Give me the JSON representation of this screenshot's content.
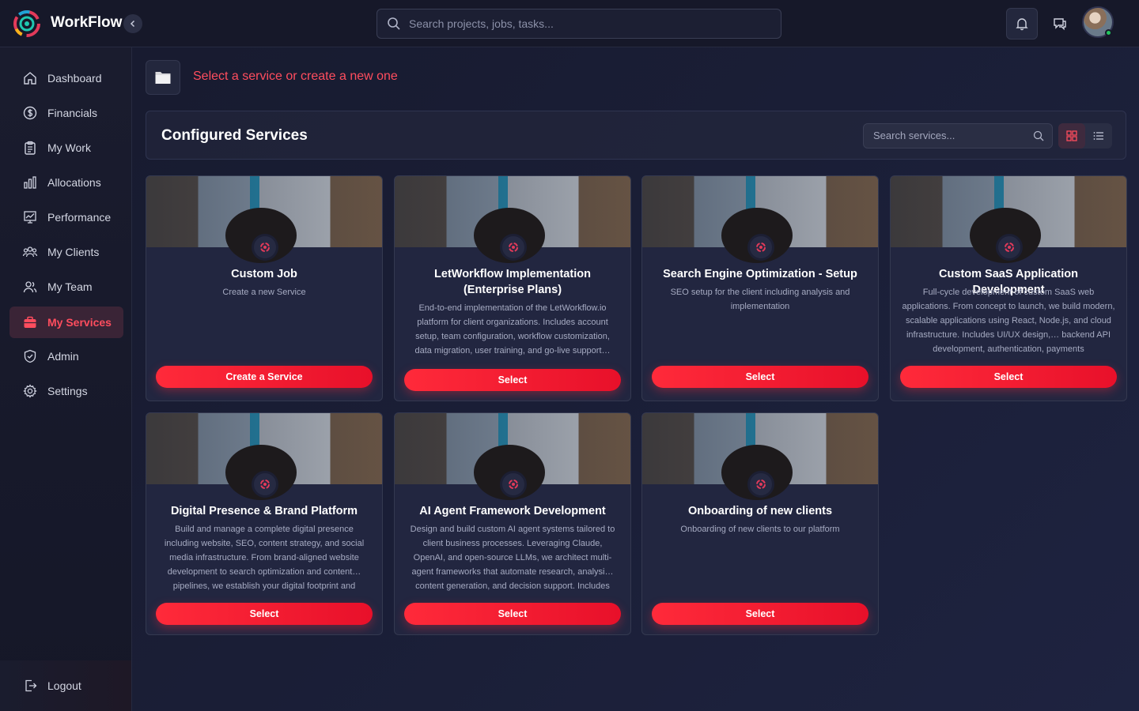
{
  "app": {
    "brand": "WorkFlow"
  },
  "search": {
    "placeholder": "Search projects, jobs, tasks..."
  },
  "sidebar": {
    "items": [
      {
        "label": "Dashboard",
        "icon": "home-icon"
      },
      {
        "label": "Financials",
        "icon": "dollar-icon"
      },
      {
        "label": "My Work",
        "icon": "clipboard-icon"
      },
      {
        "label": "Allocations",
        "icon": "bar-chart-icon"
      },
      {
        "label": "Performance",
        "icon": "trend-chart-icon"
      },
      {
        "label": "My Clients",
        "icon": "users-icon"
      },
      {
        "label": "My Team",
        "icon": "team-icon"
      },
      {
        "label": "My Services",
        "icon": "briefcase-icon",
        "active": true
      },
      {
        "label": "Admin",
        "icon": "shield-icon"
      },
      {
        "label": "Settings",
        "icon": "gear-icon"
      }
    ],
    "logout": "Logout"
  },
  "header": {
    "prompt": "Select a service or create a new one",
    "icon": "folder-icon"
  },
  "panel": {
    "title": "Configured Services",
    "search_placeholder": "Search services..."
  },
  "cards": [
    {
      "title": "Custom Job",
      "desc": "Create a new Service",
      "button": "Create a Service"
    },
    {
      "title": "LetWorkflow Implementation (Enterprise Plans)",
      "desc": "End-to-end implementation of the LetWorkflow.io platform for client organizations. Includes account setup, team configuration, workflow customization, data migration, user training, and go-live support…",
      "button": "Select"
    },
    {
      "title": "Search Engine Optimization - Setup",
      "desc": "SEO setup for the client including analysis and implementation",
      "button": "Select"
    },
    {
      "title": "Custom SaaS Application Development",
      "desc": "Full-cycle development of custom SaaS web applications. From concept to launch, we build modern, scalable applications using React, Node.js, and cloud infrastructure. Includes UI/UX design,… backend API development, authentication, payments",
      "button": "Select"
    },
    {
      "title": "Digital Presence & Brand Platform",
      "desc": "Build and manage a complete digital presence including website, SEO, content strategy, and social media infrastructure. From brand-aligned website development to search optimization and content… pipelines, we establish your digital footprint and",
      "button": "Select"
    },
    {
      "title": "AI Agent Framework Development",
      "desc": "Design and build custom AI agent systems tailored to client business processes. Leveraging Claude, OpenAI, and open-source LLMs, we architect multi-agent frameworks that automate research, analysi… content generation, and decision support. Includes",
      "button": "Select"
    },
    {
      "title": "Onboarding of new clients",
      "desc": "Onboarding of new clients to our platform",
      "button": "Select"
    }
  ],
  "colors": {
    "accent": "#ff2a3a",
    "active_text": "#ff4d5e",
    "bg": "#1a1e36"
  }
}
